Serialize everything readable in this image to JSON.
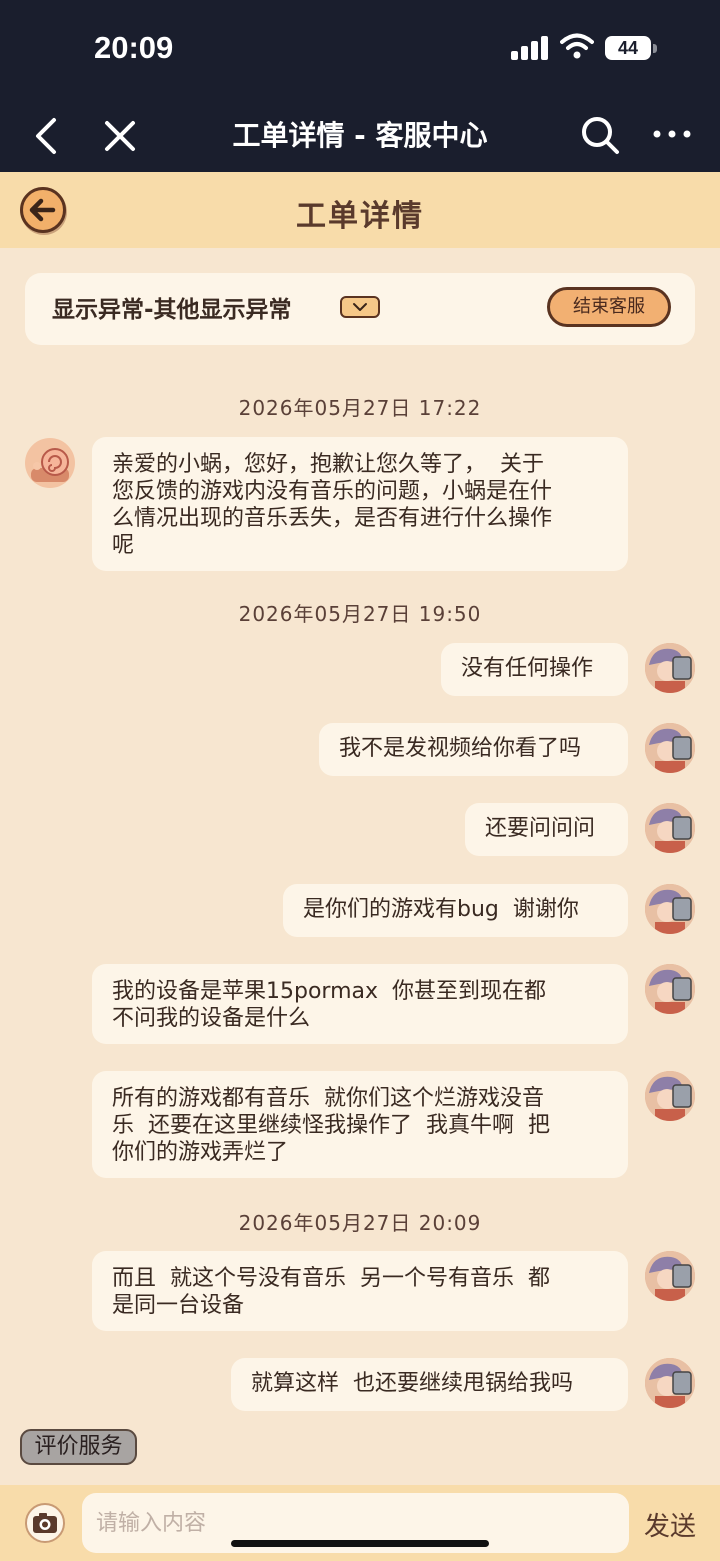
{
  "status_bar": {
    "time": "20:09",
    "battery": "44"
  },
  "nav": {
    "title": "工单详情 - 客服中心"
  },
  "header": {
    "title": "工单详情"
  },
  "category": {
    "label": "显示异常-其他显示异常",
    "end_button": "结束客服"
  },
  "messages": [
    {
      "type": "timestamp",
      "text": "2026年05月27日 17:22"
    },
    {
      "from": "agent",
      "text": "亲爱的小蜗，您好，抱歉让您久等了，  关于\n您反馈的游戏内没有音乐的问题，小蜗是在什\n么情况出现的音乐丢失，是否有进行什么操作\n呢"
    },
    {
      "type": "timestamp",
      "text": "2026年05月27日 19:50"
    },
    {
      "from": "user",
      "text": "没有任何操作"
    },
    {
      "from": "user",
      "text": "我不是发视频给你看了吗"
    },
    {
      "from": "user",
      "text": "还要问问问"
    },
    {
      "from": "user",
      "text": "是你们的游戏有bug  谢谢你"
    },
    {
      "from": "user",
      "text": "我的设备是苹果15pormax  你甚至到现在都\n不问我的设备是什么"
    },
    {
      "from": "user",
      "text": "所有的游戏都有音乐  就你们这个烂游戏没音\n乐  还要在这里继续怪我操作了  我真牛啊  把\n你们的游戏弄烂了"
    },
    {
      "type": "timestamp",
      "text": "2026年05月27日 20:09"
    },
    {
      "from": "user",
      "text": "而且  就这个号没有音乐  另一个号有音乐  都\n是同一台设备"
    },
    {
      "from": "user",
      "text": "就算这样  也还要继续甩锅给我吗"
    }
  ],
  "rate_button": "评价服务",
  "input": {
    "placeholder": "请输入内容",
    "value": ""
  },
  "send_button": "发送",
  "colors": {
    "bg": "#f7e6d0",
    "header": "#f8dcaa",
    "bubble": "#fdf5e8",
    "accent": "#f2b072",
    "dark": "#1a1e2d"
  }
}
